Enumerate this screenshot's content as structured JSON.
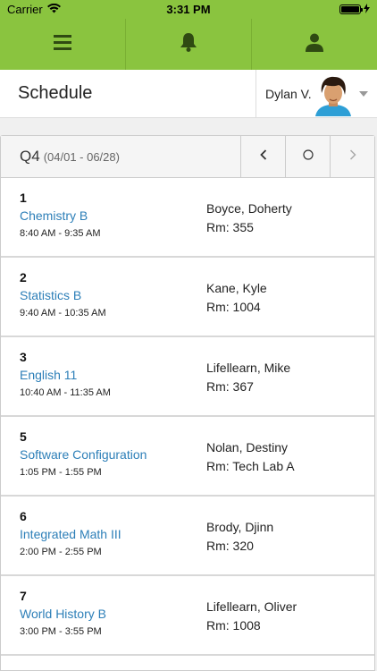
{
  "status_bar": {
    "carrier": "Carrier",
    "time": "3:31 PM"
  },
  "nav": {
    "icons": [
      "menu-icon",
      "bell-icon",
      "user-icon"
    ]
  },
  "header": {
    "title": "Schedule",
    "user_name": "Dylan V."
  },
  "quarter": {
    "label": "Q4",
    "range": "(04/01 - 06/28)"
  },
  "periods": [
    {
      "number": "1",
      "course": "Chemistry B",
      "time": "8:40 AM - 9:35 AM",
      "teacher": "Boyce, Doherty",
      "room": "Rm: 355"
    },
    {
      "number": "2",
      "course": "Statistics B",
      "time": "9:40 AM - 10:35 AM",
      "teacher": "Kane, Kyle",
      "room": "Rm: 1004"
    },
    {
      "number": "3",
      "course": "English 11",
      "time": "10:40 AM - 11:35 AM",
      "teacher": "Lifellearn, Mike",
      "room": "Rm: 367"
    },
    {
      "number": "5",
      "course": "Software Configuration",
      "time": "1:05 PM - 1:55 PM",
      "teacher": "Nolan, Destiny",
      "room": "Rm: Tech Lab A"
    },
    {
      "number": "6",
      "course": "Integrated Math III",
      "time": "2:00 PM - 2:55 PM",
      "teacher": "Brody, Djinn",
      "room": "Rm: 320"
    },
    {
      "number": "7",
      "course": "World History B",
      "time": "3:00 PM - 3:55 PM",
      "teacher": "Lifellearn, Oliver",
      "room": "Rm: 1008"
    }
  ],
  "colors": {
    "accent": "#8ac43f",
    "link": "#2d7fb8"
  }
}
